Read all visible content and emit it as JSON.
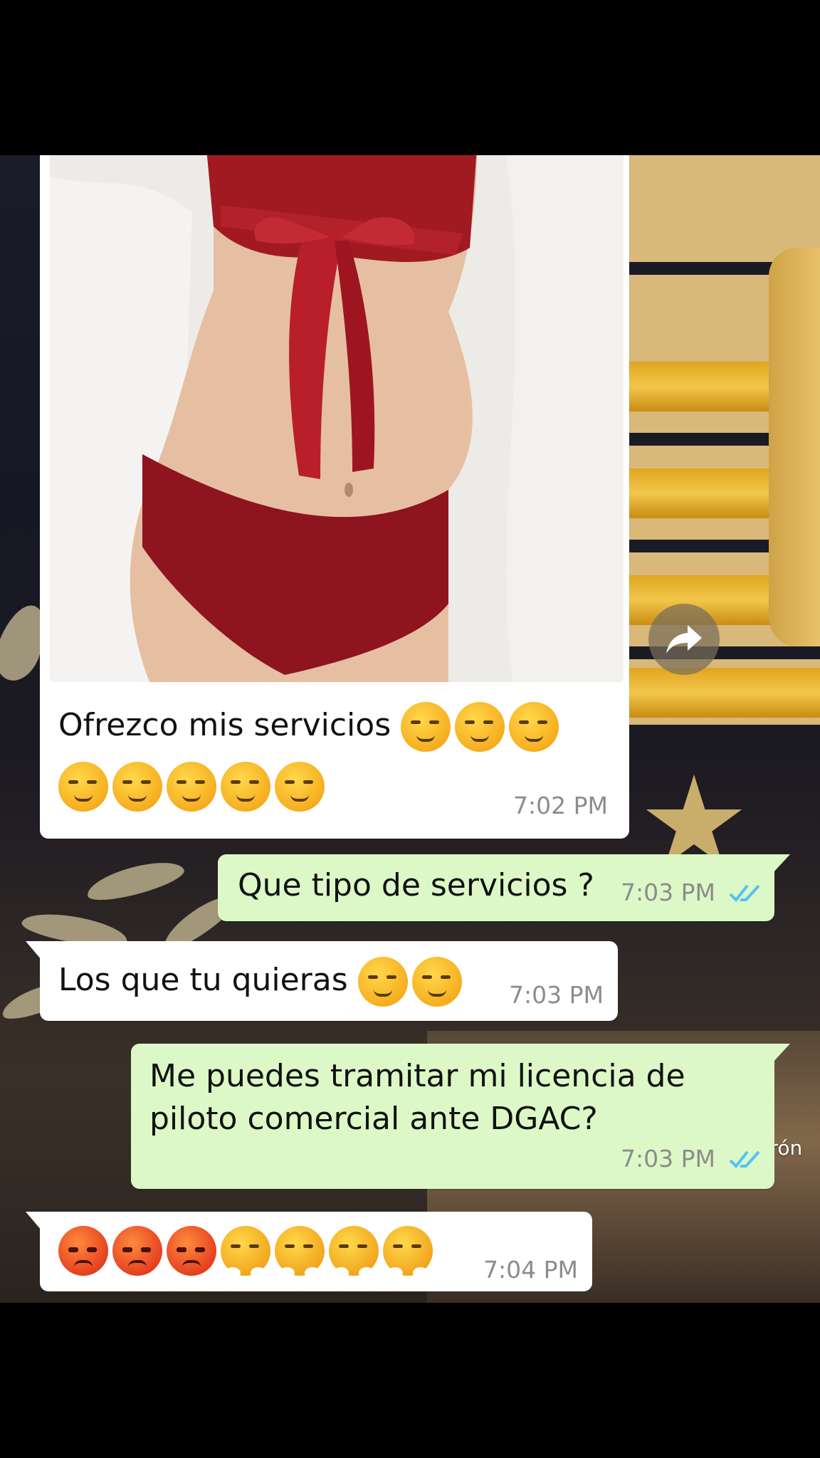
{
  "chat": {
    "messages": [
      {
        "direction": "incoming",
        "has_image": true,
        "image_alt": "photo",
        "text": "Ofrezco mis servicios",
        "emojis": [
          "smirk",
          "smirk",
          "smirk",
          "smirk",
          "smirk",
          "smirk",
          "smirk",
          "smirk"
        ],
        "time": "7:02 PM"
      },
      {
        "direction": "outgoing",
        "text": "Que tipo de servicios ?",
        "time": "7:03 PM",
        "status": "read"
      },
      {
        "direction": "incoming",
        "text": "Los que tu quieras",
        "emojis": [
          "smirk",
          "smirk"
        ],
        "time": "7:03 PM"
      },
      {
        "direction": "outgoing",
        "text_line1": "Me puedes tramitar mi licencia de",
        "text_line2": "piloto comercial ante DGAC?",
        "time": "7:03 PM",
        "status": "read"
      },
      {
        "direction": "incoming",
        "emojis": [
          "angry-face",
          "angry-face",
          "angry-face",
          "steam-face",
          "steam-face",
          "steam-face",
          "steam-face"
        ],
        "time": "7:04 PM"
      }
    ]
  },
  "watermark": "#Cap_Calderón",
  "colors": {
    "incoming_bubble": "#ffffff",
    "outgoing_bubble": "#dcf8c6",
    "read_ticks": "#4fc3f7",
    "timestamp": "#8c8c8c"
  },
  "icons": {
    "forward": "forward-arrow-icon",
    "read_receipt": "double-check-icon"
  }
}
